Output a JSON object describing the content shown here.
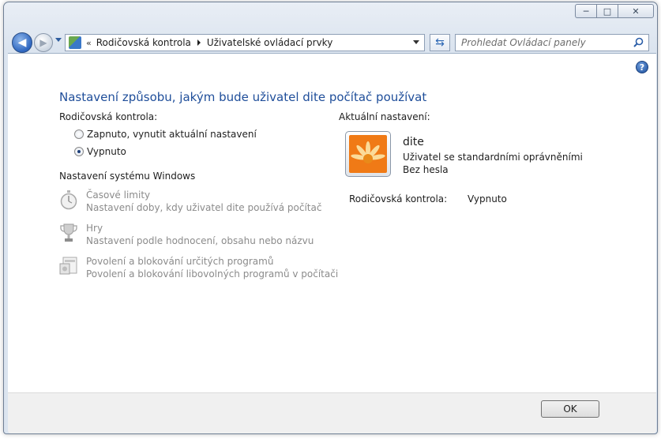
{
  "window": {
    "caption": {
      "minimize": "─",
      "maximize": "□",
      "close": "✕"
    }
  },
  "nav": {
    "breadcrumb_sep": "«",
    "breadcrumbs": [
      "Rodičovská kontrola",
      "Uživatelské ovládací prvky"
    ],
    "search_placeholder": "Prohledat Ovládací panely"
  },
  "page": {
    "title": "Nastavení způsobu, jakým bude uživatel dite počítač používat",
    "parental_label": "Rodičovská kontrola:",
    "radio_on": "Zapnuto, vynutit aktuální nastavení",
    "radio_off": "Vypnuto",
    "selected": "off",
    "windows_settings_label": "Nastavení systému Windows",
    "tasks": [
      {
        "title": "Časové limity",
        "desc": "Nastavení doby, kdy uživatel dite používá počítač",
        "icon": "stopwatch-icon"
      },
      {
        "title": "Hry",
        "desc": "Nastavení podle hodnocení, obsahu nebo názvu",
        "icon": "trophy-icon"
      },
      {
        "title": "Povolení a blokování určitých programů",
        "desc": "Povolení a blokování libovolných programů v počítači",
        "icon": "programs-icon"
      }
    ]
  },
  "current": {
    "label": "Aktuální nastavení:",
    "user_name": "dite",
    "account_type": "Uživatel se standardními oprávněními",
    "password": "Bez hesla",
    "parental_label": "Rodičovská kontrola:",
    "parental_value": "Vypnuto"
  },
  "buttons": {
    "ok": "OK"
  },
  "colors": {
    "title_blue": "#1f4e9a",
    "disabled_gray": "#8b8b8b"
  }
}
